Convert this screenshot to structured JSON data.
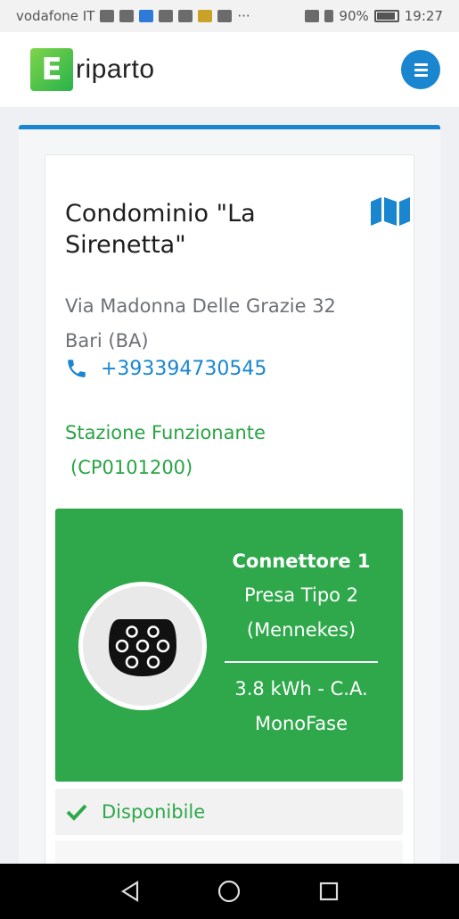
{
  "status_bar": {
    "carrier": "vodafone IT",
    "more": "···",
    "battery_percent": "90%",
    "time": "19:27"
  },
  "app": {
    "logo_letter": "E",
    "logo_text": "riparto"
  },
  "station": {
    "name": "Condominio \"La Sirenetta\"",
    "address_line1": "Via Madonna Delle Grazie 32",
    "address_line2": "Bari (BA)",
    "phone": "+393394730545",
    "status": "Stazione Funzionante",
    "station_code": "(CP0101200)"
  },
  "connector": {
    "title": "Connettore 1",
    "type_line1": "Presa Tipo 2",
    "type_line2": "(Mennekes)",
    "power_line1": "3.8 kWh - C.A.",
    "power_line2": "MonoFase",
    "availability": "Disponibile",
    "bg_color": "#2ea84a"
  },
  "colors": {
    "accent": "#1a86d0",
    "success": "#29a444"
  },
  "icons": [
    "map-icon",
    "phone-icon",
    "type2-plug-icon",
    "check-icon",
    "menu-icon",
    "back-icon",
    "home-icon",
    "recents-icon"
  ]
}
